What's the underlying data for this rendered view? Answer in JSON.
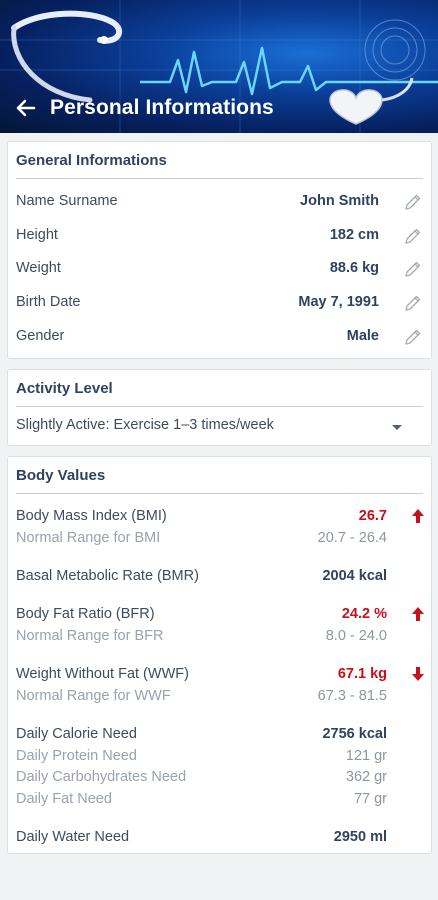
{
  "header": {
    "title": "Personal Informations"
  },
  "general": {
    "title": "General Informations",
    "rows": [
      {
        "label": "Name Surname",
        "value": "John Smith"
      },
      {
        "label": "Height",
        "value": "182 cm"
      },
      {
        "label": "Weight",
        "value": "88.6 kg"
      },
      {
        "label": "Birth Date",
        "value": "May 7, 1991"
      },
      {
        "label": "Gender",
        "value": "Male"
      }
    ]
  },
  "activity": {
    "title": "Activity Level",
    "selected": "Slightly Active: Exercise 1–3 times/week"
  },
  "body": {
    "title": "Body Values",
    "bmi": {
      "label": "Body Mass Index (BMI)",
      "value": "26.7",
      "range_label": "Normal Range for BMI",
      "range": "20.7 - 26.4",
      "trend": "up"
    },
    "bmr": {
      "label": "Basal Metabolic Rate (BMR)",
      "value": "2004 kcal"
    },
    "bfr": {
      "label": "Body Fat Ratio (BFR)",
      "value": "24.2 %",
      "range_label": "Normal Range for BFR",
      "range": "8.0 - 24.0",
      "trend": "up"
    },
    "wwf": {
      "label": "Weight Without Fat (WWF)",
      "value": "67.1 kg",
      "range_label": "Normal Range for WWF",
      "range": "67.3 - 81.5",
      "trend": "down"
    },
    "calorie": {
      "label": "Daily Calorie Need",
      "value": "2756 kcal"
    },
    "protein": {
      "label": "Daily Protein Need",
      "value": "121 gr"
    },
    "carbs": {
      "label": "Daily Carbohydrates Need",
      "value": "362 gr"
    },
    "fat": {
      "label": "Daily Fat Need",
      "value": "77 gr"
    },
    "water": {
      "label": "Daily Water Need",
      "value": "2950 ml"
    }
  },
  "colors": {
    "accent_red": "#c8101b",
    "title_blue": "#2f4260",
    "header_blue": "#0b3f9a"
  },
  "icons": {
    "back": "arrow-left-icon",
    "edit": "pencil-icon",
    "up": "arrow-up-icon",
    "down": "arrow-down-icon",
    "dropdown": "caret-down-icon"
  }
}
